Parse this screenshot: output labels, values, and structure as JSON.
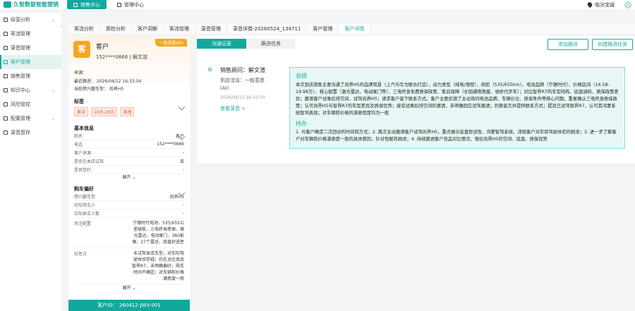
{
  "app": {
    "name": "久智数联智能营销"
  },
  "topnav": {
    "sales": "销售中心",
    "admin": "管理中心",
    "store": "临汾宝诚"
  },
  "sidebar": {
    "items": [
      {
        "label": "经营分析"
      },
      {
        "label": "客流管理"
      },
      {
        "label": "录音管理"
      },
      {
        "label": "客户管理"
      },
      {
        "label": "销售管理"
      },
      {
        "label": "知识中心"
      },
      {
        "label": "风险管控"
      },
      {
        "label": "配置管理"
      },
      {
        "label": "录音暂存"
      }
    ]
  },
  "tabs": [
    "客流分析",
    "质检分析",
    "客户洞察",
    "客流管理",
    "录音管理",
    "录音详情-20260524_134711",
    "客户管理",
    "客户详情"
  ],
  "customer": {
    "avatar_char": "客",
    "name": "客户",
    "phone_line": "152****0666 | 解文渲",
    "level": "一般意愿(AI)",
    "source_label": "来源：",
    "last_visit": "最近跟进：  2026/04/12 16:33:54",
    "intent_model": "当前感兴趣车型：  尚界H5"
  },
  "tags_section": {
    "title": "标签",
    "tags": [
      "首访",
      "16万-20万",
      "其他"
    ]
  },
  "basic_section": {
    "title": "基本信息",
    "rows": [
      {
        "k": "姓名",
        "v": "客户"
      },
      {
        "k": "电话",
        "v": "152****0666"
      },
      {
        "k": "客户来源",
        "v": "-"
      },
      {
        "k": "是否在本店试驾",
        "v": "否"
      },
      {
        "k": "是否签约",
        "v": "-"
      }
    ],
    "more": "展开"
  },
  "pref_section": {
    "title": "购车偏好",
    "rows": [
      {
        "k": "感兴趣车型",
        "v": "尚界H5"
      },
      {
        "k": "实际用车人",
        "v": "-"
      },
      {
        "k": "实际乘车人数",
        "v": "-"
      },
      {
        "k": "关注配置",
        "v": "宁德时代电池、535/655公里续航、三电终身质保、激光雷达、电动尾门、360影像、27个雷达、底盘舒适性"
      },
      {
        "k": "抗性点",
        "v": "未试驾本店车型，对实际驾驶体验存疑；仍在对比竞品智界R7，未明确偏好；购车时间不确定；对车辆和价格满意度一般"
      }
    ],
    "more": "展开"
  },
  "footer": {
    "id": "客户ID：  260412-JWX-001"
  },
  "detail": {
    "seg_tabs": [
      "沟通记录",
      "跟进任务"
    ],
    "add_follow": "添加跟进",
    "create_task": "创建跟进任务",
    "tl_title": "销售顾问：解文渲",
    "tl_visit": "到店洽谈：一般意愿",
    "tl_ai": "(AI)",
    "tl_time": "2026/04/12 16:33:54",
    "tl_link": "查看录音 >",
    "summary_title": "总结",
    "summary_text": "本次到店销售主要沟通了尚界H5的品牌背景（上汽与华为联合打造）、动力类型（纯电/增程）、续航（535/655km）、电池品牌（宁德时代）、价格区间（16.58-19.98万）、核心配置（激光雷达、电动尾门等）、三电终身免费质保政策、售后保障（全国通用救援、维修代步车）；对比智界R7的车型结构、底盘调校、质保政策差异；邀请客户试乘后排空间、试驾尚界H5；请求客户留下联系方式。客户主要反馈了主动询问电池品牌、车辆价位、质保条件等核心问题，重复确认三电终身质保政策；认可尚界H5与智界R7的车型差异及质保优势；接受试乘后排空间的邀请，未明确回应试驾邀请；同意留言并提供联系方式；提及已试驾智界R7，认可其鸿蒙系统智驾表现；对车辆和价格的满意程度均为一般",
    "todo_title": "待办",
    "todo_text": "1. 与客户确定二次回访的时间和方式；2. 再次主动邀请客户试驾尚界H5，重点展示底盘舒适性、鸿蒙智驾系统，消除客户对实际驾驶体验的顾虑；3. 进一步了解客户对车辆和价格满意度一般的具体原因，针对性解答顾虑；4. 持续跟进客户竞品对比情况，强化尚界H5的空间、底盘、质保优势"
  }
}
